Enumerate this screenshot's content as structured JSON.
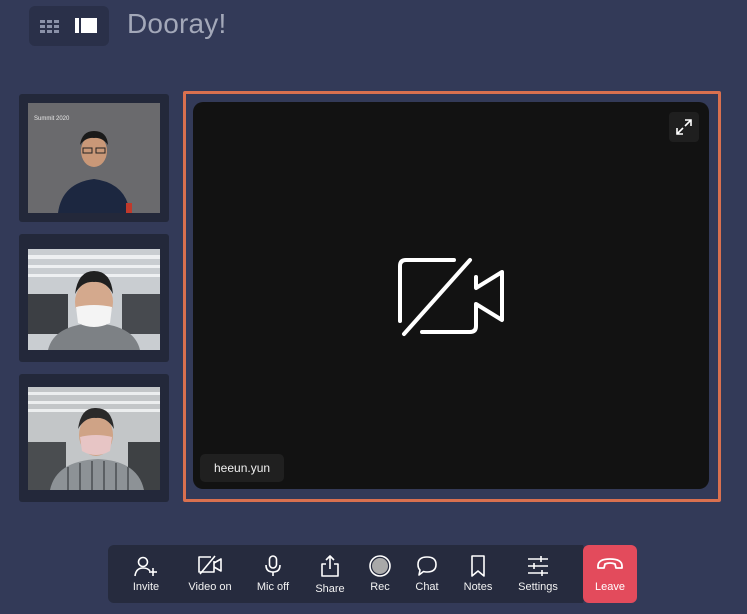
{
  "header": {
    "brand": "Dooray!",
    "view_buttons": [
      {
        "name": "grid-view-icon"
      },
      {
        "name": "speaker-view-icon"
      }
    ]
  },
  "participants": [
    {
      "name": "participant-1",
      "sign_text": "Summit 2020"
    },
    {
      "name": "participant-2"
    },
    {
      "name": "participant-3"
    }
  ],
  "stage": {
    "name_tag": "heeun.yun",
    "icon": "camera-off-icon",
    "expand_icon": "expand-icon"
  },
  "toolbar": {
    "buttons": [
      {
        "label": "Invite",
        "icon": "add-user-icon"
      },
      {
        "label": "Video on",
        "icon": "video-off-icon"
      },
      {
        "label": "Mic off",
        "icon": "microphone-icon"
      },
      {
        "label": "Share",
        "icon": "share-icon"
      },
      {
        "label": "Rec",
        "icon": "record-icon"
      },
      {
        "label": "Chat",
        "icon": "chat-icon"
      },
      {
        "label": "Notes",
        "icon": "bookmark-icon"
      },
      {
        "label": "Settings",
        "icon": "sliders-icon"
      }
    ],
    "leave_label": "Leave",
    "leave_icon": "hang-up-icon"
  },
  "colors": {
    "background": "#333a58",
    "active_frame": "#d9704f",
    "leave": "#e34b5c"
  }
}
